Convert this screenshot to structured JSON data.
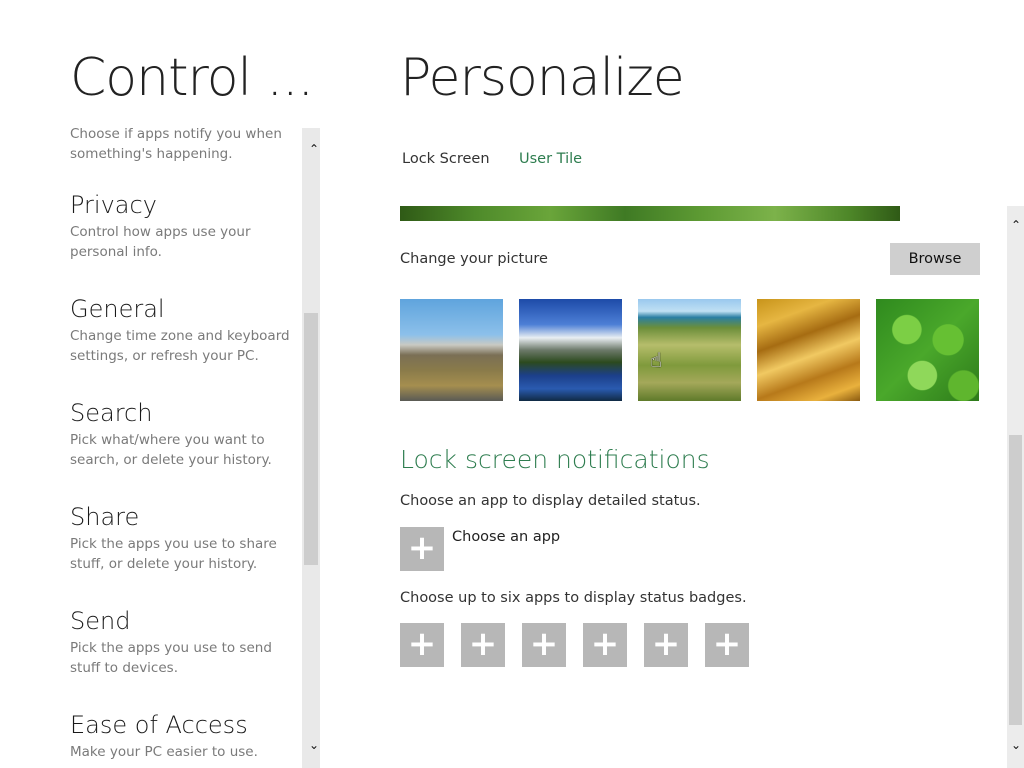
{
  "left_pane": {
    "title": "Control ...",
    "partial_item_desc": "Choose if apps notify you when something's happening.",
    "items": [
      {
        "name": "Privacy",
        "desc": "Control how apps use your personal info."
      },
      {
        "name": "General",
        "desc": "Change time zone and keyboard settings, or refresh your PC."
      },
      {
        "name": "Search",
        "desc": "Pick what/where you want to search, or delete your history."
      },
      {
        "name": "Share",
        "desc": "Pick the apps you use to share stuff, or delete your history."
      },
      {
        "name": "Send",
        "desc": "Pick the apps you use to send stuff to devices."
      },
      {
        "name": "Ease of Access",
        "desc": "Make your PC easier to use."
      }
    ],
    "scroll_up": "⌃",
    "scroll_down": "⌄"
  },
  "right_pane": {
    "title": "Personalize",
    "tabs": [
      {
        "label": "Lock Screen"
      },
      {
        "label": "User Tile"
      }
    ],
    "change_picture_label": "Change your picture",
    "browse_label": "Browse",
    "pictures": [
      "mountain-road",
      "mountain-lake",
      "coastal-grassland",
      "golden-grass",
      "green-clover"
    ],
    "lock_screen_notifications": {
      "title": "Lock screen notifications",
      "detailed_status_text": "Choose an app to display detailed status.",
      "choose_app_label": "Choose an app",
      "badges_text": "Choose up to six apps to display status badges.",
      "plus": "+",
      "badge_slots": 6
    },
    "scroll_up": "⌃",
    "scroll_down": "⌄"
  },
  "colors": {
    "accent_green": "#2e7d4f",
    "plus_tile": "#b7b7b7",
    "browse_button": "#cfcfcf"
  }
}
